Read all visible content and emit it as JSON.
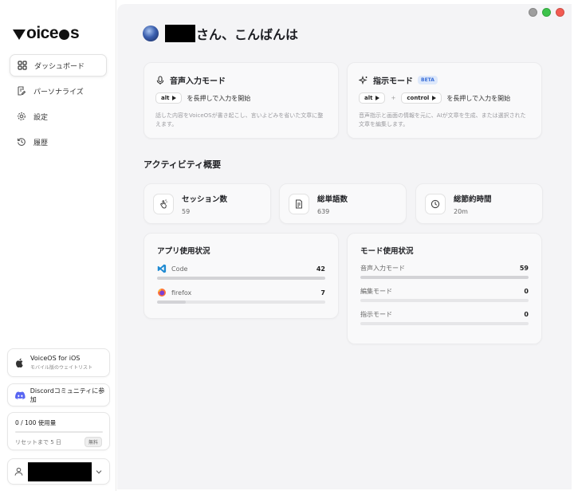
{
  "sidebar": {
    "logo": "voiceos",
    "nav": [
      {
        "label": "ダッシュボード",
        "icon": "grid-icon"
      },
      {
        "label": "パーソナライズ",
        "icon": "doc-edit-icon"
      },
      {
        "label": "設定",
        "icon": "gear-icon"
      },
      {
        "label": "履歴",
        "icon": "history-icon"
      }
    ],
    "ios": {
      "title": "VoiceOS for iOS",
      "subtitle": "モバイル版のウェイトリスト"
    },
    "discord": {
      "label": "Discordコミュニティに参加"
    },
    "usage": {
      "title": "0 / 100 使用量",
      "progress": 0,
      "reset": "リセットまで 5 日",
      "badge": "無料"
    }
  },
  "main": {
    "greeting": "さん、こんばんは",
    "modes": [
      {
        "title": "音声入力モード",
        "icon": "mic-icon",
        "keys": [
          "alt"
        ],
        "hint": "を長押しで入力を開始",
        "desc": "話した内容をVoiceOSが書き起こし、言いよどみを省いた文章に整えます。"
      },
      {
        "title": "指示モード",
        "icon": "sparkle-icon",
        "badge": "BETA",
        "keys": [
          "alt",
          "control"
        ],
        "plus": "+",
        "hint": "を長押しで入力を開始",
        "desc": "音声指示と画面の情報を元に、AIが文章を生成、または選択された文章を編集します。"
      }
    ],
    "activity_title": "アクティビティ概要",
    "stats": [
      {
        "label": "セッション数",
        "value": "59",
        "icon": "hand-icon"
      },
      {
        "label": "総単語数",
        "value": "639",
        "icon": "document-icon"
      },
      {
        "label": "総節約時間",
        "value": "20m",
        "icon": "clock-icon"
      }
    ],
    "app_usage": {
      "title": "アプリ使用状況",
      "items": [
        {
          "name": "Code",
          "value": "42",
          "fraction": 1.0,
          "icon": "vscode-icon"
        },
        {
          "name": "firefox",
          "value": "7",
          "fraction": 0.17,
          "icon": "firefox-icon"
        }
      ]
    },
    "mode_usage": {
      "title": "モード使用状況",
      "items": [
        {
          "name": "音声入力モード",
          "value": "59",
          "fraction": 1.0
        },
        {
          "name": "編集モード",
          "value": "0",
          "fraction": 0
        },
        {
          "name": "指示モード",
          "value": "0",
          "fraction": 0
        }
      ]
    }
  },
  "window_controls": [
    {
      "name": "minimize",
      "color": "#9e9e9e"
    },
    {
      "name": "maximize",
      "color": "#3cc24b"
    },
    {
      "name": "close",
      "color": "#f25b52"
    }
  ]
}
